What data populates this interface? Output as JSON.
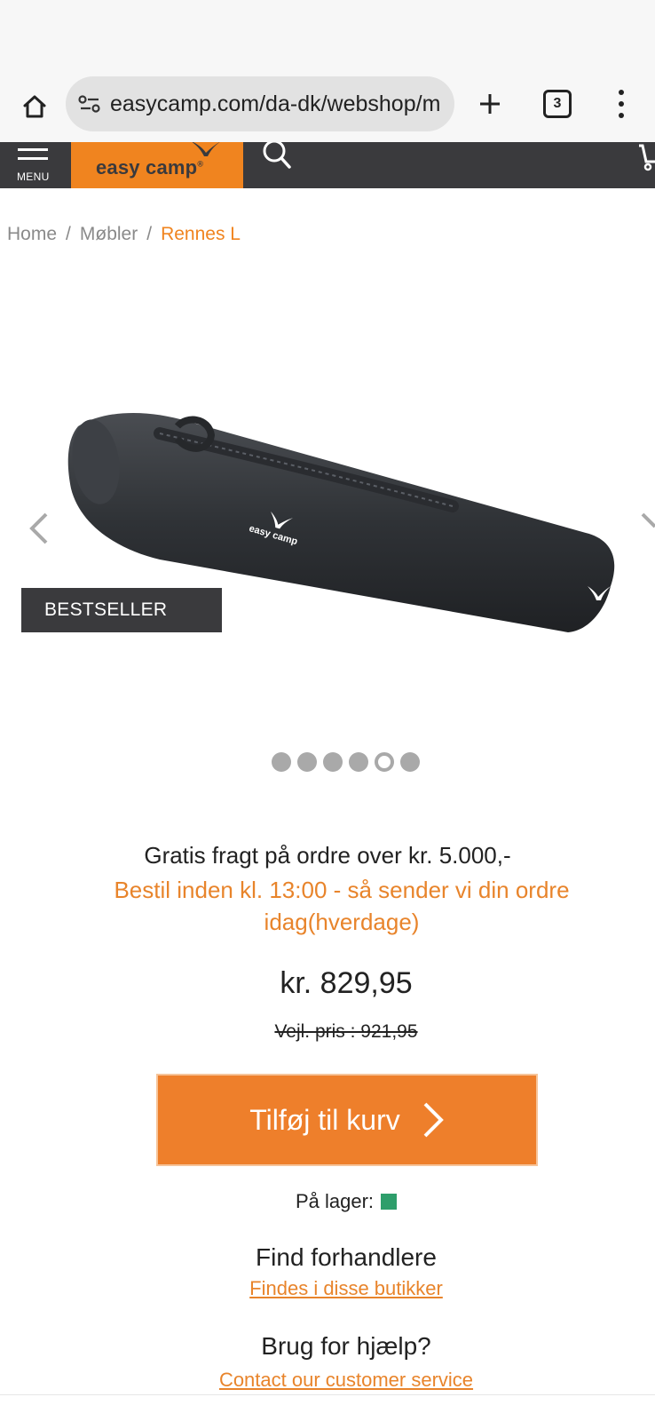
{
  "browser": {
    "url": "easycamp.com/da-dk/webshop/m",
    "tab_count": "3",
    "icons": [
      "home-icon",
      "site-settings-icon",
      "new-tab-icon",
      "tab-switcher-icon",
      "more-menu-icon"
    ]
  },
  "header": {
    "menu_label": "MENU",
    "logo_text": "easy camp",
    "logo_trademark": "®",
    "colors": {
      "bar": "#3a3a3d",
      "brand": "#f0841f"
    }
  },
  "breadcrumb": {
    "items": [
      "Home",
      "Møbler"
    ],
    "separator": "/",
    "current": "Rennes L"
  },
  "gallery": {
    "badge": "BESTSELLER",
    "image_alt": "easy camp",
    "dot_count": 6,
    "active_dot": 5
  },
  "info": {
    "free_shipping": "Gratis fragt på ordre over kr. 5.000,-",
    "order_note": "Bestil inden kl. 13:00 - så sender vi din ordre idag(hverdage)",
    "price": "kr. 829,95",
    "old_price": "Vejl. pris : 921,95",
    "add_to_cart": "Tilføj til kurv",
    "stock_label": "På lager:",
    "stock_color": "#2e9e6b",
    "find_title": "Find forhandlere",
    "find_link": "Findes i disse butikker",
    "help_title": "Brug for hjælp?",
    "help_link": "Contact our customer service"
  }
}
